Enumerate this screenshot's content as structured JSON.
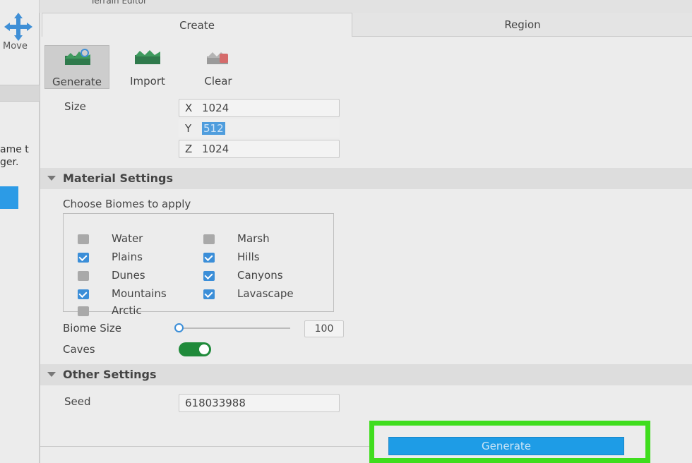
{
  "background": {
    "move_label": "Move",
    "text_line1": "ame t",
    "text_line2": "ger."
  },
  "window": {
    "title": "Terrain Editor"
  },
  "tabs": [
    {
      "label": "Create",
      "active": true
    },
    {
      "label": "Region",
      "active": false
    }
  ],
  "toolbar": {
    "generate": {
      "label": "Generate",
      "icon": "generate-terrain-icon",
      "selected": true
    },
    "import": {
      "label": "Import",
      "icon": "import-terrain-icon"
    },
    "clear": {
      "label": "Clear",
      "icon": "clear-terrain-icon"
    }
  },
  "size": {
    "label": "Size",
    "x": {
      "axis": "X",
      "value": "1024"
    },
    "y": {
      "axis": "Y",
      "value": "512"
    },
    "z": {
      "axis": "Z",
      "value": "1024"
    }
  },
  "material_settings": {
    "title": "Material Settings",
    "biomes_label": "Choose Biomes to apply",
    "biomes": [
      {
        "name": "Water",
        "checked": false
      },
      {
        "name": "Marsh",
        "checked": false
      },
      {
        "name": "Plains",
        "checked": true
      },
      {
        "name": "Hills",
        "checked": true
      },
      {
        "name": "Dunes",
        "checked": false
      },
      {
        "name": "Canyons",
        "checked": true
      },
      {
        "name": "Mountains",
        "checked": true
      },
      {
        "name": "Lavascape",
        "checked": true
      },
      {
        "name": "Arctic",
        "checked": false
      }
    ],
    "biome_size_label": "Biome Size",
    "biome_size_value": "100",
    "caves_label": "Caves",
    "caves_enabled": true
  },
  "other_settings": {
    "title": "Other Settings",
    "seed_label": "Seed",
    "seed_value": "618033988"
  },
  "generate_button": {
    "label": "Generate"
  },
  "colors": {
    "accent_blue": "#1e9ce6",
    "toggle_green": "#1f8a3a",
    "highlight_green": "#3fdd1d"
  }
}
